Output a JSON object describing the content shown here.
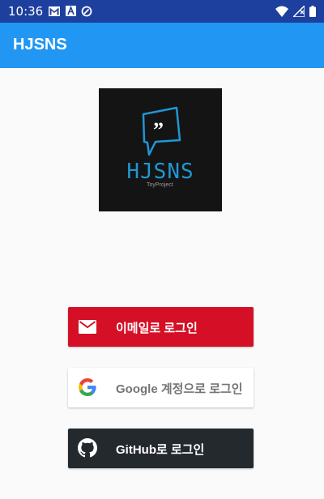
{
  "status_bar": {
    "time": "10:36",
    "notification_icons": [
      "gmail-icon",
      "font-icon",
      "compass-icon"
    ],
    "system_icons": [
      "wifi-icon",
      "no-signal-icon",
      "battery-icon"
    ],
    "bg_color": "#1d3f9e"
  },
  "app_bar": {
    "title": "HJSNS",
    "bg_color": "#2196f3"
  },
  "logo": {
    "text": "HJSNS",
    "subtitle": "ToyProject",
    "glyph": "”",
    "accent": "#1f97d3"
  },
  "buttons": {
    "email": {
      "label": "이메일로 로그인",
      "icon": "mail-icon",
      "color": "#d50f25"
    },
    "google": {
      "label": "Google 계정으로 로그인",
      "icon": "google-icon",
      "color": "#ffffff"
    },
    "github": {
      "label": "GitHub로 로그인",
      "icon": "github-icon",
      "color": "#24292e"
    }
  }
}
